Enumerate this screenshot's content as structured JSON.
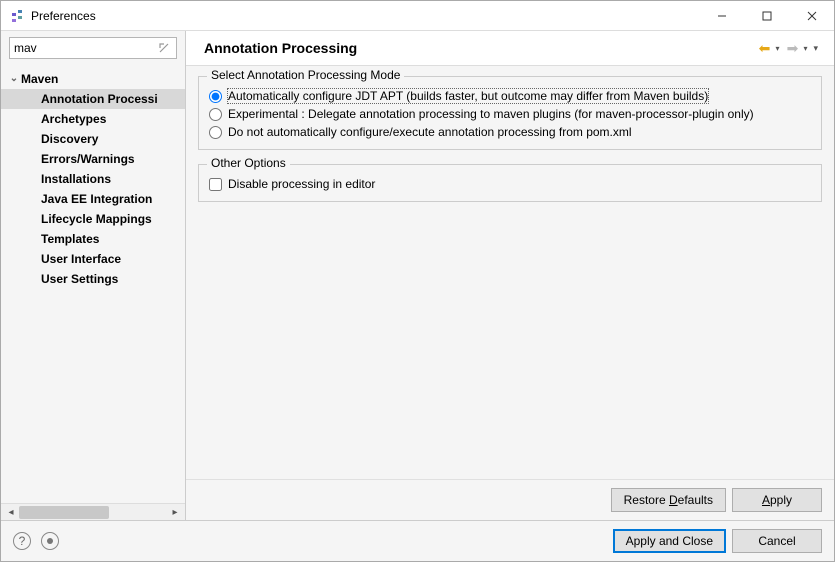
{
  "window": {
    "title": "Preferences"
  },
  "search": {
    "value": "mav"
  },
  "tree": {
    "root": {
      "label": "Maven",
      "expanded": true
    },
    "children": [
      {
        "label": "Annotation Processi",
        "selected": true
      },
      {
        "label": "Archetypes"
      },
      {
        "label": "Discovery"
      },
      {
        "label": "Errors/Warnings"
      },
      {
        "label": "Installations"
      },
      {
        "label": "Java EE Integration"
      },
      {
        "label": "Lifecycle Mappings"
      },
      {
        "label": "Templates"
      },
      {
        "label": "User Interface"
      },
      {
        "label": "User Settings"
      }
    ]
  },
  "page": {
    "title": "Annotation Processing",
    "modeGroup": {
      "title": "Select Annotation Processing Mode",
      "options": [
        {
          "label": "Automatically configure JDT APT (builds faster, but outcome may differ from Maven builds)",
          "checked": true
        },
        {
          "label": "Experimental : Delegate annotation processing to maven plugins (for maven-processor-plugin only)",
          "checked": false
        },
        {
          "label": "Do not automatically configure/execute annotation processing from pom.xml",
          "checked": false
        }
      ]
    },
    "otherGroup": {
      "title": "Other Options",
      "options": [
        {
          "label": "Disable processing in editor",
          "checked": false
        }
      ]
    }
  },
  "buttons": {
    "restoreDefaults": "Restore Defaults",
    "apply": "Apply",
    "applyAndClose": "Apply and Close",
    "cancel": "Cancel"
  }
}
